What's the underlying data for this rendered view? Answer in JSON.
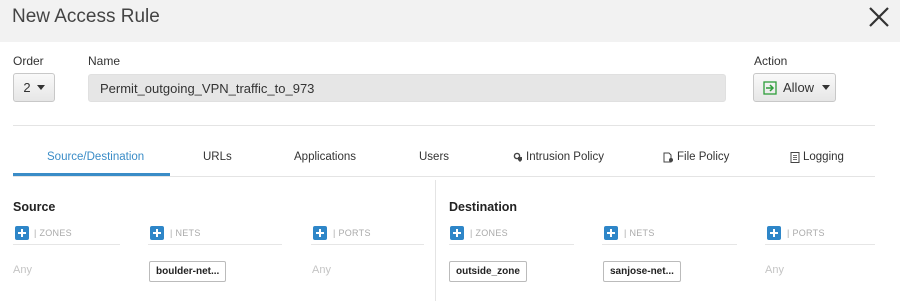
{
  "dialog": {
    "title": "New Access Rule"
  },
  "icons": {
    "close": "close-icon",
    "allow": "allow-arrow-icon",
    "intrusion": "shield-gear-icon",
    "file": "file-icon",
    "logging": "document-icon",
    "add": "plus-icon"
  },
  "colors": {
    "accent": "#3a8cc7",
    "add_button": "#2e86c8",
    "allow_icon": "#2e9e3b"
  },
  "fields": {
    "order_label": "Order",
    "order_value": "2",
    "name_label": "Name",
    "name_value": "Permit_outgoing_VPN_traffic_to_973",
    "action_label": "Action",
    "action_value": "Allow"
  },
  "tabs": [
    {
      "label": "Source/Destination",
      "active": true
    },
    {
      "label": "URLs",
      "active": false
    },
    {
      "label": "Applications",
      "active": false
    },
    {
      "label": "Users",
      "active": false
    },
    {
      "label": "Intrusion Policy",
      "active": false
    },
    {
      "label": "File Policy",
      "active": false
    },
    {
      "label": "Logging",
      "active": false
    }
  ],
  "source": {
    "title": "Source",
    "zones_label": "| ZONES",
    "nets_label": "| NETS",
    "ports_label": "| PORTS",
    "zones_value": "Any",
    "nets_value": "boulder-net...",
    "ports_value": "Any"
  },
  "destination": {
    "title": "Destination",
    "zones_label": "| ZONES",
    "nets_label": "| NETS",
    "ports_label": "| PORTS",
    "zones_value": "outside_zone",
    "nets_value": "sanjose-net...",
    "ports_value": "Any"
  }
}
